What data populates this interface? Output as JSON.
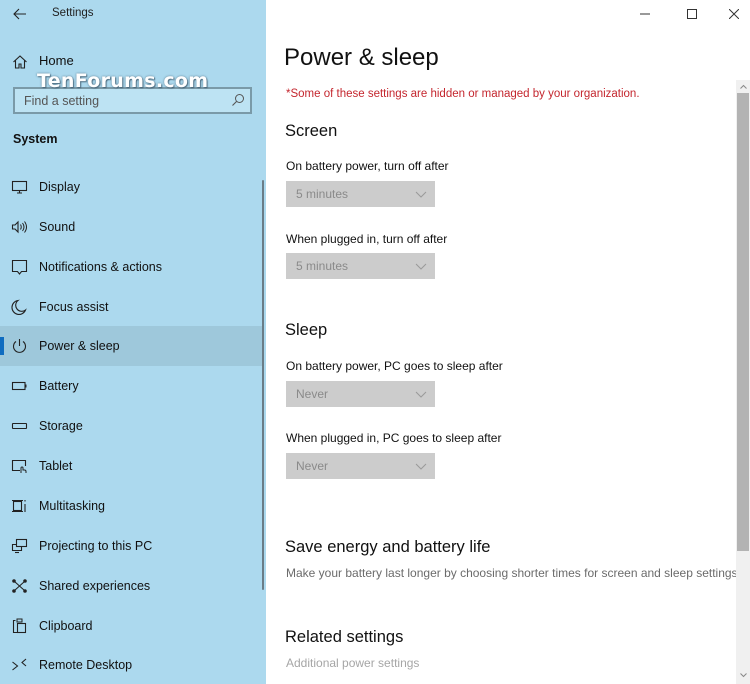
{
  "window": {
    "app_title": "Settings",
    "controls": {
      "minimize": "minimize-icon",
      "maximize": "maximize-icon",
      "close": "close-icon"
    }
  },
  "watermark": "TenForums.com",
  "sidebar": {
    "back_icon": "arrow-left-icon",
    "home": {
      "label": "Home",
      "icon": "home-icon"
    },
    "search": {
      "placeholder": "Find a setting",
      "value": "",
      "icon": "search-icon"
    },
    "section": "System",
    "items": [
      {
        "label": "Display",
        "icon": "display-icon",
        "selected": false
      },
      {
        "label": "Sound",
        "icon": "speaker-icon",
        "selected": false
      },
      {
        "label": "Notifications & actions",
        "icon": "notification-icon",
        "selected": false
      },
      {
        "label": "Focus assist",
        "icon": "moon-icon",
        "selected": false
      },
      {
        "label": "Power & sleep",
        "icon": "power-icon",
        "selected": true
      },
      {
        "label": "Battery",
        "icon": "battery-icon",
        "selected": false
      },
      {
        "label": "Storage",
        "icon": "storage-icon",
        "selected": false
      },
      {
        "label": "Tablet",
        "icon": "tablet-icon",
        "selected": false
      },
      {
        "label": "Multitasking",
        "icon": "multitasking-icon",
        "selected": false
      },
      {
        "label": "Projecting to this PC",
        "icon": "projecting-icon",
        "selected": false
      },
      {
        "label": "Shared experiences",
        "icon": "shared-experiences-icon",
        "selected": false
      },
      {
        "label": "Clipboard",
        "icon": "clipboard-icon",
        "selected": false
      },
      {
        "label": "Remote Desktop",
        "icon": "remote-desktop-icon",
        "selected": false
      }
    ]
  },
  "main": {
    "title": "Power & sleep",
    "org_note": "*Some of these settings are hidden or managed by your organization.",
    "screen": {
      "heading": "Screen",
      "battery_label": "On battery power, turn off after",
      "battery_value": "5 minutes",
      "plugged_label": "When plugged in, turn off after",
      "plugged_value": "5 minutes"
    },
    "sleep": {
      "heading": "Sleep",
      "battery_label": "On battery power, PC goes to sleep after",
      "battery_value": "Never",
      "plugged_label": "When plugged in, PC goes to sleep after",
      "plugged_value": "Never"
    },
    "save_energy": {
      "heading": "Save energy and battery life",
      "description": "Make your battery last longer by choosing shorter times for screen and sleep settings."
    },
    "related": {
      "heading": "Related settings",
      "link": "Additional power settings"
    }
  },
  "colors": {
    "sidebar_bg": "#acd9ee",
    "selected_bg": "#9ec8db",
    "accent": "#0f6cc0",
    "org_note": "#c4262e",
    "dropdown_disabled_bg": "#cccccc"
  }
}
